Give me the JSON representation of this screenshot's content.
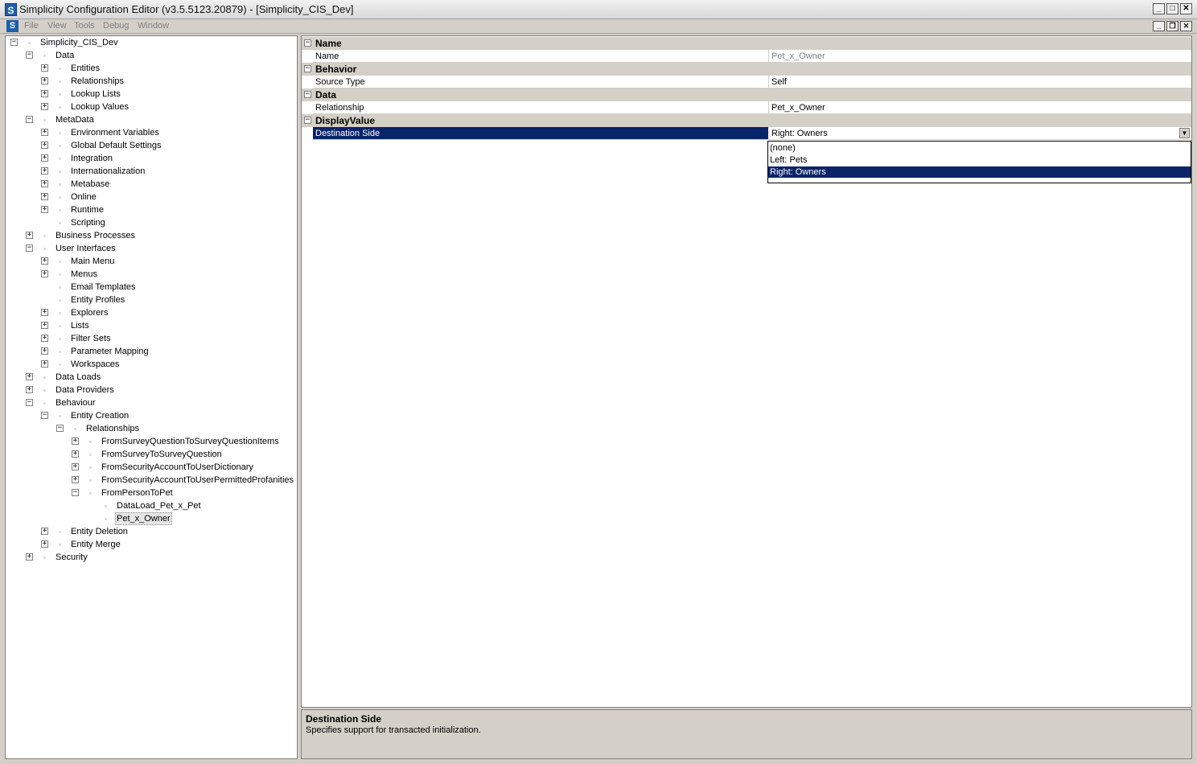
{
  "window": {
    "title": "Simplicity Configuration Editor (v3.5.5123.20879) - [Simplicity_CIS_Dev]",
    "app_icon": "S"
  },
  "menu": {
    "items": [
      "File",
      "View",
      "Tools",
      "Debug",
      "Window"
    ]
  },
  "tree": [
    {
      "label": "Simplicity_CIS_Dev",
      "depth": 0,
      "exp": "-"
    },
    {
      "label": "Data",
      "depth": 1,
      "exp": "-"
    },
    {
      "label": "Entities",
      "depth": 2,
      "exp": "+"
    },
    {
      "label": "Relationships",
      "depth": 2,
      "exp": "+"
    },
    {
      "label": "Lookup Lists",
      "depth": 2,
      "exp": "+"
    },
    {
      "label": "Lookup Values",
      "depth": 2,
      "exp": "+"
    },
    {
      "label": "MetaData",
      "depth": 1,
      "exp": "-"
    },
    {
      "label": "Environment Variables",
      "depth": 2,
      "exp": "+"
    },
    {
      "label": "Global Default Settings",
      "depth": 2,
      "exp": "+"
    },
    {
      "label": "Integration",
      "depth": 2,
      "exp": "+"
    },
    {
      "label": "Internationalization",
      "depth": 2,
      "exp": "+"
    },
    {
      "label": "Metabase",
      "depth": 2,
      "exp": "+"
    },
    {
      "label": "Online",
      "depth": 2,
      "exp": "+"
    },
    {
      "label": "Runtime",
      "depth": 2,
      "exp": "+"
    },
    {
      "label": "Scripting",
      "depth": 2,
      "exp": ""
    },
    {
      "label": "Business Processes",
      "depth": 1,
      "exp": "+"
    },
    {
      "label": "User Interfaces",
      "depth": 1,
      "exp": "-"
    },
    {
      "label": "Main Menu",
      "depth": 2,
      "exp": "+"
    },
    {
      "label": "Menus",
      "depth": 2,
      "exp": "+"
    },
    {
      "label": "Email Templates",
      "depth": 2,
      "exp": ""
    },
    {
      "label": "Entity Profiles",
      "depth": 2,
      "exp": ""
    },
    {
      "label": "Explorers",
      "depth": 2,
      "exp": "+"
    },
    {
      "label": "Lists",
      "depth": 2,
      "exp": "+"
    },
    {
      "label": "Filter Sets",
      "depth": 2,
      "exp": "+"
    },
    {
      "label": "Parameter Mapping",
      "depth": 2,
      "exp": "+"
    },
    {
      "label": "Workspaces",
      "depth": 2,
      "exp": "+"
    },
    {
      "label": "Data Loads",
      "depth": 1,
      "exp": "+"
    },
    {
      "label": "Data Providers",
      "depth": 1,
      "exp": "+"
    },
    {
      "label": "Behaviour",
      "depth": 1,
      "exp": "-"
    },
    {
      "label": "Entity Creation",
      "depth": 2,
      "exp": "-"
    },
    {
      "label": "Relationships",
      "depth": 3,
      "exp": "-"
    },
    {
      "label": "FromSurveyQuestionToSurveyQuestionItems",
      "depth": 4,
      "exp": "+"
    },
    {
      "label": "FromSurveyToSurveyQuestion",
      "depth": 4,
      "exp": "+"
    },
    {
      "label": "FromSecurityAccountToUserDictionary",
      "depth": 4,
      "exp": "+"
    },
    {
      "label": "FromSecurityAccountToUserPermittedProfanities",
      "depth": 4,
      "exp": "+"
    },
    {
      "label": "FromPersonToPet",
      "depth": 4,
      "exp": "-"
    },
    {
      "label": "DataLoad_Pet_x_Pet",
      "depth": 5,
      "exp": ""
    },
    {
      "label": "Pet_x_Owner",
      "depth": 5,
      "exp": "",
      "selected": true
    },
    {
      "label": "Entity Deletion",
      "depth": 2,
      "exp": "+"
    },
    {
      "label": "Entity Merge",
      "depth": 2,
      "exp": "+"
    },
    {
      "label": "Security",
      "depth": 1,
      "exp": "+"
    }
  ],
  "properties": {
    "categories": [
      {
        "label": "Name",
        "rows": [
          {
            "name": "Name",
            "value": "Pet_x_Owner",
            "muted": true
          }
        ]
      },
      {
        "label": "Behavior",
        "rows": [
          {
            "name": "Source Type",
            "value": "Self"
          }
        ]
      },
      {
        "label": "Data",
        "rows": [
          {
            "name": "Relationship",
            "value": "Pet_x_Owner"
          }
        ]
      },
      {
        "label": "DisplayValue",
        "rows": [
          {
            "name": "Destination Side",
            "value": "Right: Owners",
            "selected": true
          }
        ]
      }
    ],
    "dropdown": {
      "options": [
        "(none)",
        "Left: Pets",
        "Right: Owners"
      ],
      "selected_index": 2
    }
  },
  "help": {
    "title": "Destination Side",
    "description": "Specifies support for transacted initialization."
  }
}
